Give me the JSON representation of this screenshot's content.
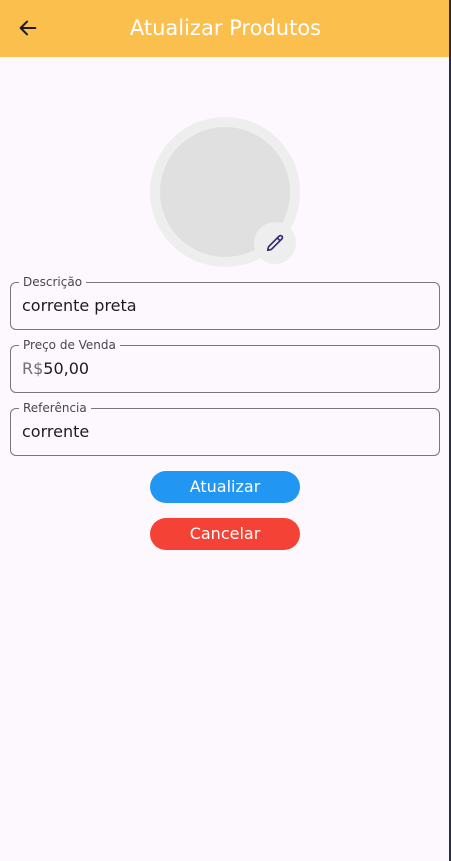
{
  "appbar": {
    "title": "Atualizar Produtos",
    "back_icon": "arrow-left-icon",
    "background_color": "#fbbf4e"
  },
  "image_picker": {
    "edit_icon": "pencil-icon"
  },
  "form": {
    "descricao": {
      "label": "Descrição",
      "value": "corrente preta"
    },
    "preco": {
      "label": "Preço de Venda",
      "prefix": "R$",
      "value": "50,00"
    },
    "referencia": {
      "label": "Referência",
      "value": "corrente"
    }
  },
  "buttons": {
    "update_label": "Atualizar",
    "update_color": "#2196f3",
    "cancel_label": "Cancelar",
    "cancel_color": "#f44336"
  }
}
